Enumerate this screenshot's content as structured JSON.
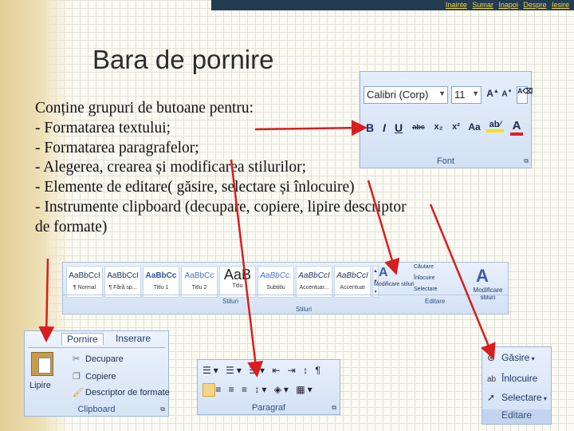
{
  "nav": {
    "links": [
      "Inainte",
      "Sumar",
      "Inapoi",
      "Despre",
      "Iesire"
    ]
  },
  "slide": {
    "title": "Bara de pornire",
    "lines": [
      "Conține grupuri de butoane pentru:",
      "- Formatarea textului;",
      "- Formatarea paragrafelor;",
      "- Alegerea, crearea și modificarea stilurilor;",
      "- Elemente de editare( găsire, selectare și înlocuire)",
      "- Instrumente clipboard (decupare, copiere, lipire descriptor",
      "de formate)"
    ]
  },
  "font_group": {
    "font_name": "Calibri (Corp)",
    "font_size": "11",
    "buttons": [
      "B",
      "I",
      "U",
      "abc",
      "x₂",
      "x²",
      "Aa",
      "ab⁄",
      "A"
    ],
    "label": "Font"
  },
  "styles_group": {
    "tiles": [
      {
        "sample": "AaBbCcI",
        "name": "¶ Normal"
      },
      {
        "sample": "AaBbCcI",
        "name": "¶ Fără sp..."
      },
      {
        "sample": "AaBbCc",
        "name": "Titlu 1"
      },
      {
        "sample": "AaBbCc",
        "name": "Titlu 2"
      },
      {
        "sample": "AaB",
        "name": "Titlu"
      },
      {
        "sample": "AaBbCc.",
        "name": "Subtitlu"
      },
      {
        "sample": "AaBbCcI",
        "name": "Accentuar..."
      },
      {
        "sample": "AaBbCcI",
        "name": "Accentuat"
      }
    ],
    "modify_label": "Modificare stiluri",
    "find_label": "Căutare",
    "replace_label": "Înlocuire",
    "select_label": "Selectare",
    "label_small": "Stiluri",
    "label": "Stiluri",
    "edit_label": "Editare",
    "modify_big": "Modificare stiluri"
  },
  "clipboard_group": {
    "tabs": [
      "Pornire",
      "Inserare"
    ],
    "paste_label": "Lipire",
    "cut_label": "Decupare",
    "copy_label": "Copiere",
    "format_painter_label": "Descriptor de formate",
    "label": "Clipboard"
  },
  "paragraph_group": {
    "row1": "☰▾ ☰▾ ☰▾ ⇤ ⇥ ↕ ¶",
    "row2": "≡ ≡ ≡ ≡ ↕▾ ◈▾ ▦▾",
    "label": "Paragraf"
  },
  "editing_group": {
    "find_label": "Găsire",
    "replace_label": "Înlocuire",
    "select_label": "Selectare",
    "label": "Editare"
  },
  "colors": {
    "nav_bg": "#233c52",
    "nav_link": "#f0d64a",
    "arrow": "#d81e1e",
    "ribbon_border": "#9db5d9"
  }
}
